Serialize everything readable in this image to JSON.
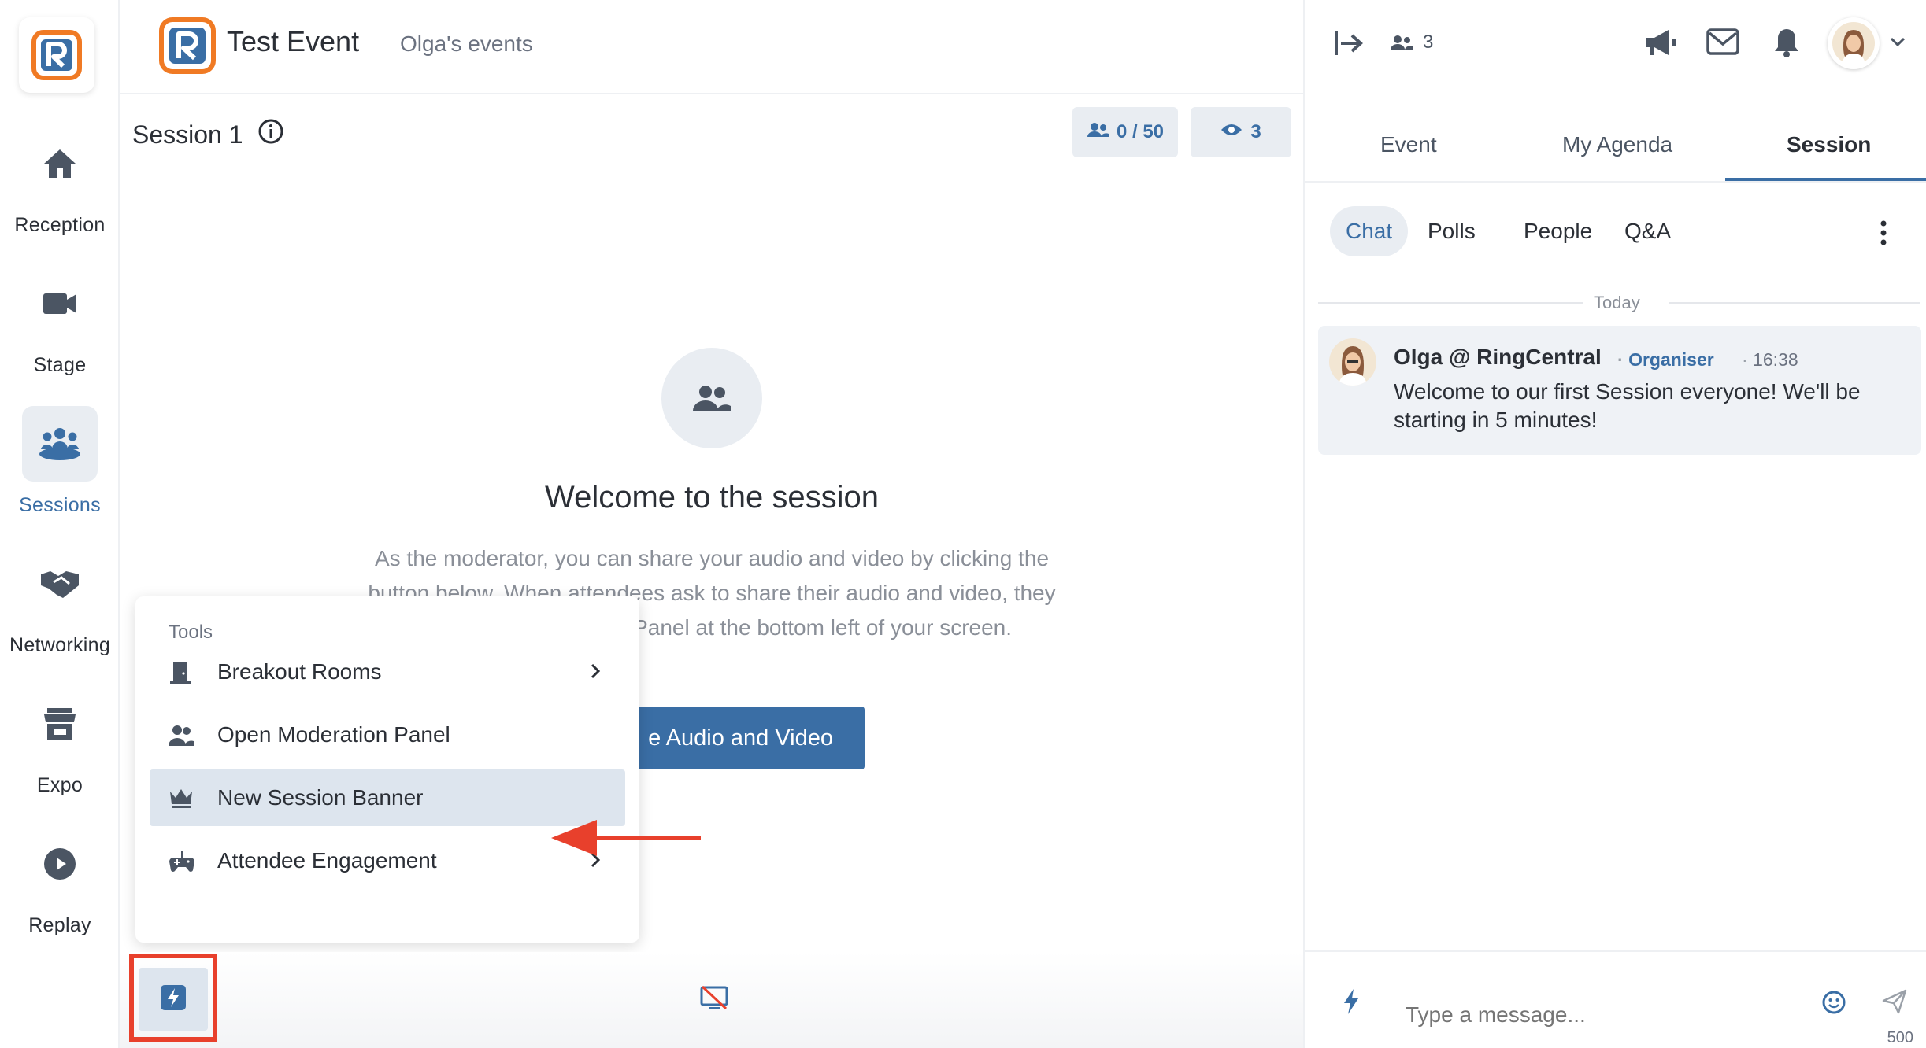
{
  "app": {
    "brand_letter": "R",
    "brand_color": "#3a6ea5",
    "brand_accent": "#f07a24"
  },
  "leftnav": {
    "items": [
      {
        "label": "Reception",
        "icon": "home-icon"
      },
      {
        "label": "Stage",
        "icon": "video-camera-icon"
      },
      {
        "label": "Sessions",
        "icon": "group-icon",
        "active": true
      },
      {
        "label": "Networking",
        "icon": "handshake-icon"
      },
      {
        "label": "Expo",
        "icon": "storefront-icon"
      },
      {
        "label": "Replay",
        "icon": "play-icon"
      }
    ]
  },
  "header": {
    "event_title": "Test Event",
    "event_owner": "Olga's events"
  },
  "session": {
    "title": "Session 1",
    "attendees": "0 / 50",
    "viewers": "3"
  },
  "welcome": {
    "title": "Welcome to the session",
    "body_line1": "As the moderator, you can share your audio and video by clicking the",
    "body_line2": "button below. When attendees ask to share their audio and video, they",
    "body_line3": "ion Panel at the bottom left of your screen.",
    "share_button": "e Audio and Video"
  },
  "tools": {
    "heading": "Tools",
    "items": [
      {
        "label": "Breakout Rooms",
        "icon": "door-icon",
        "has_submenu": true
      },
      {
        "label": "Open Moderation Panel",
        "icon": "people-icon",
        "has_submenu": false
      },
      {
        "label": "New Session Banner",
        "icon": "crown-icon",
        "has_submenu": false,
        "highlighted": true
      },
      {
        "label": "Attendee Engagement",
        "icon": "gamepad-icon",
        "has_submenu": true
      }
    ]
  },
  "annotation": {
    "color": "#e8402c"
  },
  "right_panel": {
    "online_count": "3",
    "tabs": [
      "Event",
      "My Agenda",
      "Session"
    ],
    "active_tab": "Session",
    "subtabs": [
      "Chat",
      "Polls",
      "People",
      "Q&A"
    ],
    "active_subtab": "Chat",
    "day_divider": "Today",
    "message": {
      "author": "Olga @ RingCentral",
      "role": "Organiser",
      "time": "16:38",
      "text": "Welcome to our first Session everyone! We'll be starting in 5 minutes!"
    },
    "composer": {
      "placeholder": "Type a message...",
      "char_limit": "500"
    }
  }
}
